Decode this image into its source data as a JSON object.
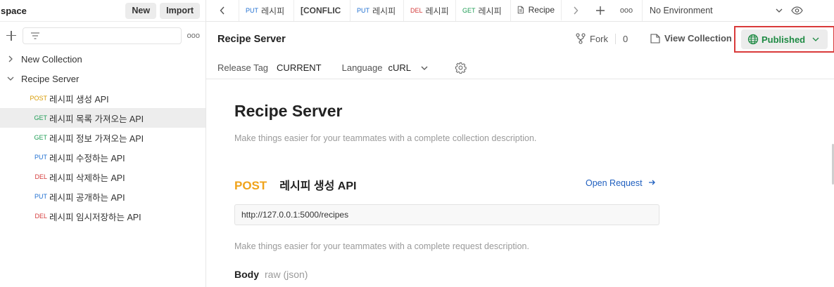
{
  "sidebar": {
    "workspace_title": "space",
    "new_label": "New",
    "import_label": "Import",
    "more_label": "ooo",
    "collections": [
      {
        "name": "New Collection",
        "expanded": false
      },
      {
        "name": "Recipe Server",
        "expanded": true
      }
    ],
    "requests": [
      {
        "method": "POST",
        "name": "레시피 생성 API",
        "active": false
      },
      {
        "method": "GET",
        "name": "레시피 목록 가져오는 API",
        "active": true
      },
      {
        "method": "GET",
        "name": "레시피 정보 가져오는 API",
        "active": false
      },
      {
        "method": "PUT",
        "name": "레시피 수정하는 API",
        "active": false
      },
      {
        "method": "DEL",
        "name": "레시피 삭제하는 API",
        "active": false
      },
      {
        "method": "PUT",
        "name": "레시피 공개하는 API",
        "active": false
      },
      {
        "method": "DEL",
        "name": "레시피 임시저장하는 API",
        "active": false
      }
    ]
  },
  "tabs": [
    {
      "method": "PUT",
      "label": "레시피"
    },
    {
      "method": "",
      "label": "[CONFLIC"
    },
    {
      "method": "PUT",
      "label": "레시피"
    },
    {
      "method": "DEL",
      "label": "레시피"
    },
    {
      "method": "GET",
      "label": "레시피"
    },
    {
      "method": "",
      "label": "Recipe"
    }
  ],
  "tabbar": {
    "environment": "No Environment",
    "more_label": "ooo"
  },
  "header": {
    "title": "Recipe Server",
    "fork_label": "Fork",
    "fork_count": "0",
    "view_collection_label": "View Collection",
    "published_label": "Published",
    "release_tag_label": "Release Tag",
    "release_tag_value": "CURRENT",
    "language_label": "Language",
    "language_value": "cURL"
  },
  "content": {
    "title": "Recipe Server",
    "collection_description": "Make things easier for your teammates with a complete collection description.",
    "request_method": "POST",
    "request_name": "레시피 생성 API",
    "open_request_label": "Open Request",
    "url": "http://127.0.0.1:5000/recipes",
    "request_description": "Make things easier for your teammates with a complete request description.",
    "body_label": "Body",
    "body_type": "raw (json)"
  },
  "colors": {
    "accent_published": "#1e8a43",
    "highlight_border": "#d93a3a",
    "post": "#f0a31a",
    "get": "#1f9d55",
    "put": "#1f6fd1",
    "del": "#d43b3b"
  }
}
